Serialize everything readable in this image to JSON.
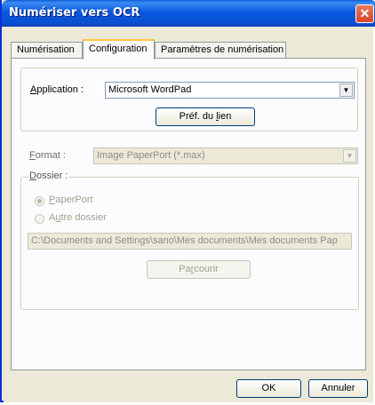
{
  "window": {
    "title": "Numériser vers OCR"
  },
  "tabs": [
    {
      "label": "Numérisation"
    },
    {
      "label": "Configuration"
    },
    {
      "label": "Paramètres de numérisation"
    }
  ],
  "application": {
    "label_underlined": "A",
    "label_rest": "pplication :",
    "value": "Microsoft WordPad",
    "link_button_pre": "Préf. du ",
    "link_button_underlined": "l",
    "link_button_post": "ien"
  },
  "format": {
    "label_underlined": "F",
    "label_rest": "ormat :",
    "value": "Image PaperPort (*.max)"
  },
  "dossier": {
    "label_underlined": "D",
    "label_rest": "ossier :",
    "options": [
      {
        "underlined": "P",
        "rest": "aperPort",
        "checked": true
      },
      {
        "underlined_prefix": "A",
        "underlined": "u",
        "rest": "tre dossier",
        "checked": false
      }
    ],
    "path": "C:\\Documents and Settings\\sano\\Mes documents\\Mes documents Pap",
    "browse_pre": "Pa",
    "browse_underlined": "r",
    "browse_post": "courir"
  },
  "footer": {
    "ok": "OK",
    "cancel": "Annuler"
  }
}
